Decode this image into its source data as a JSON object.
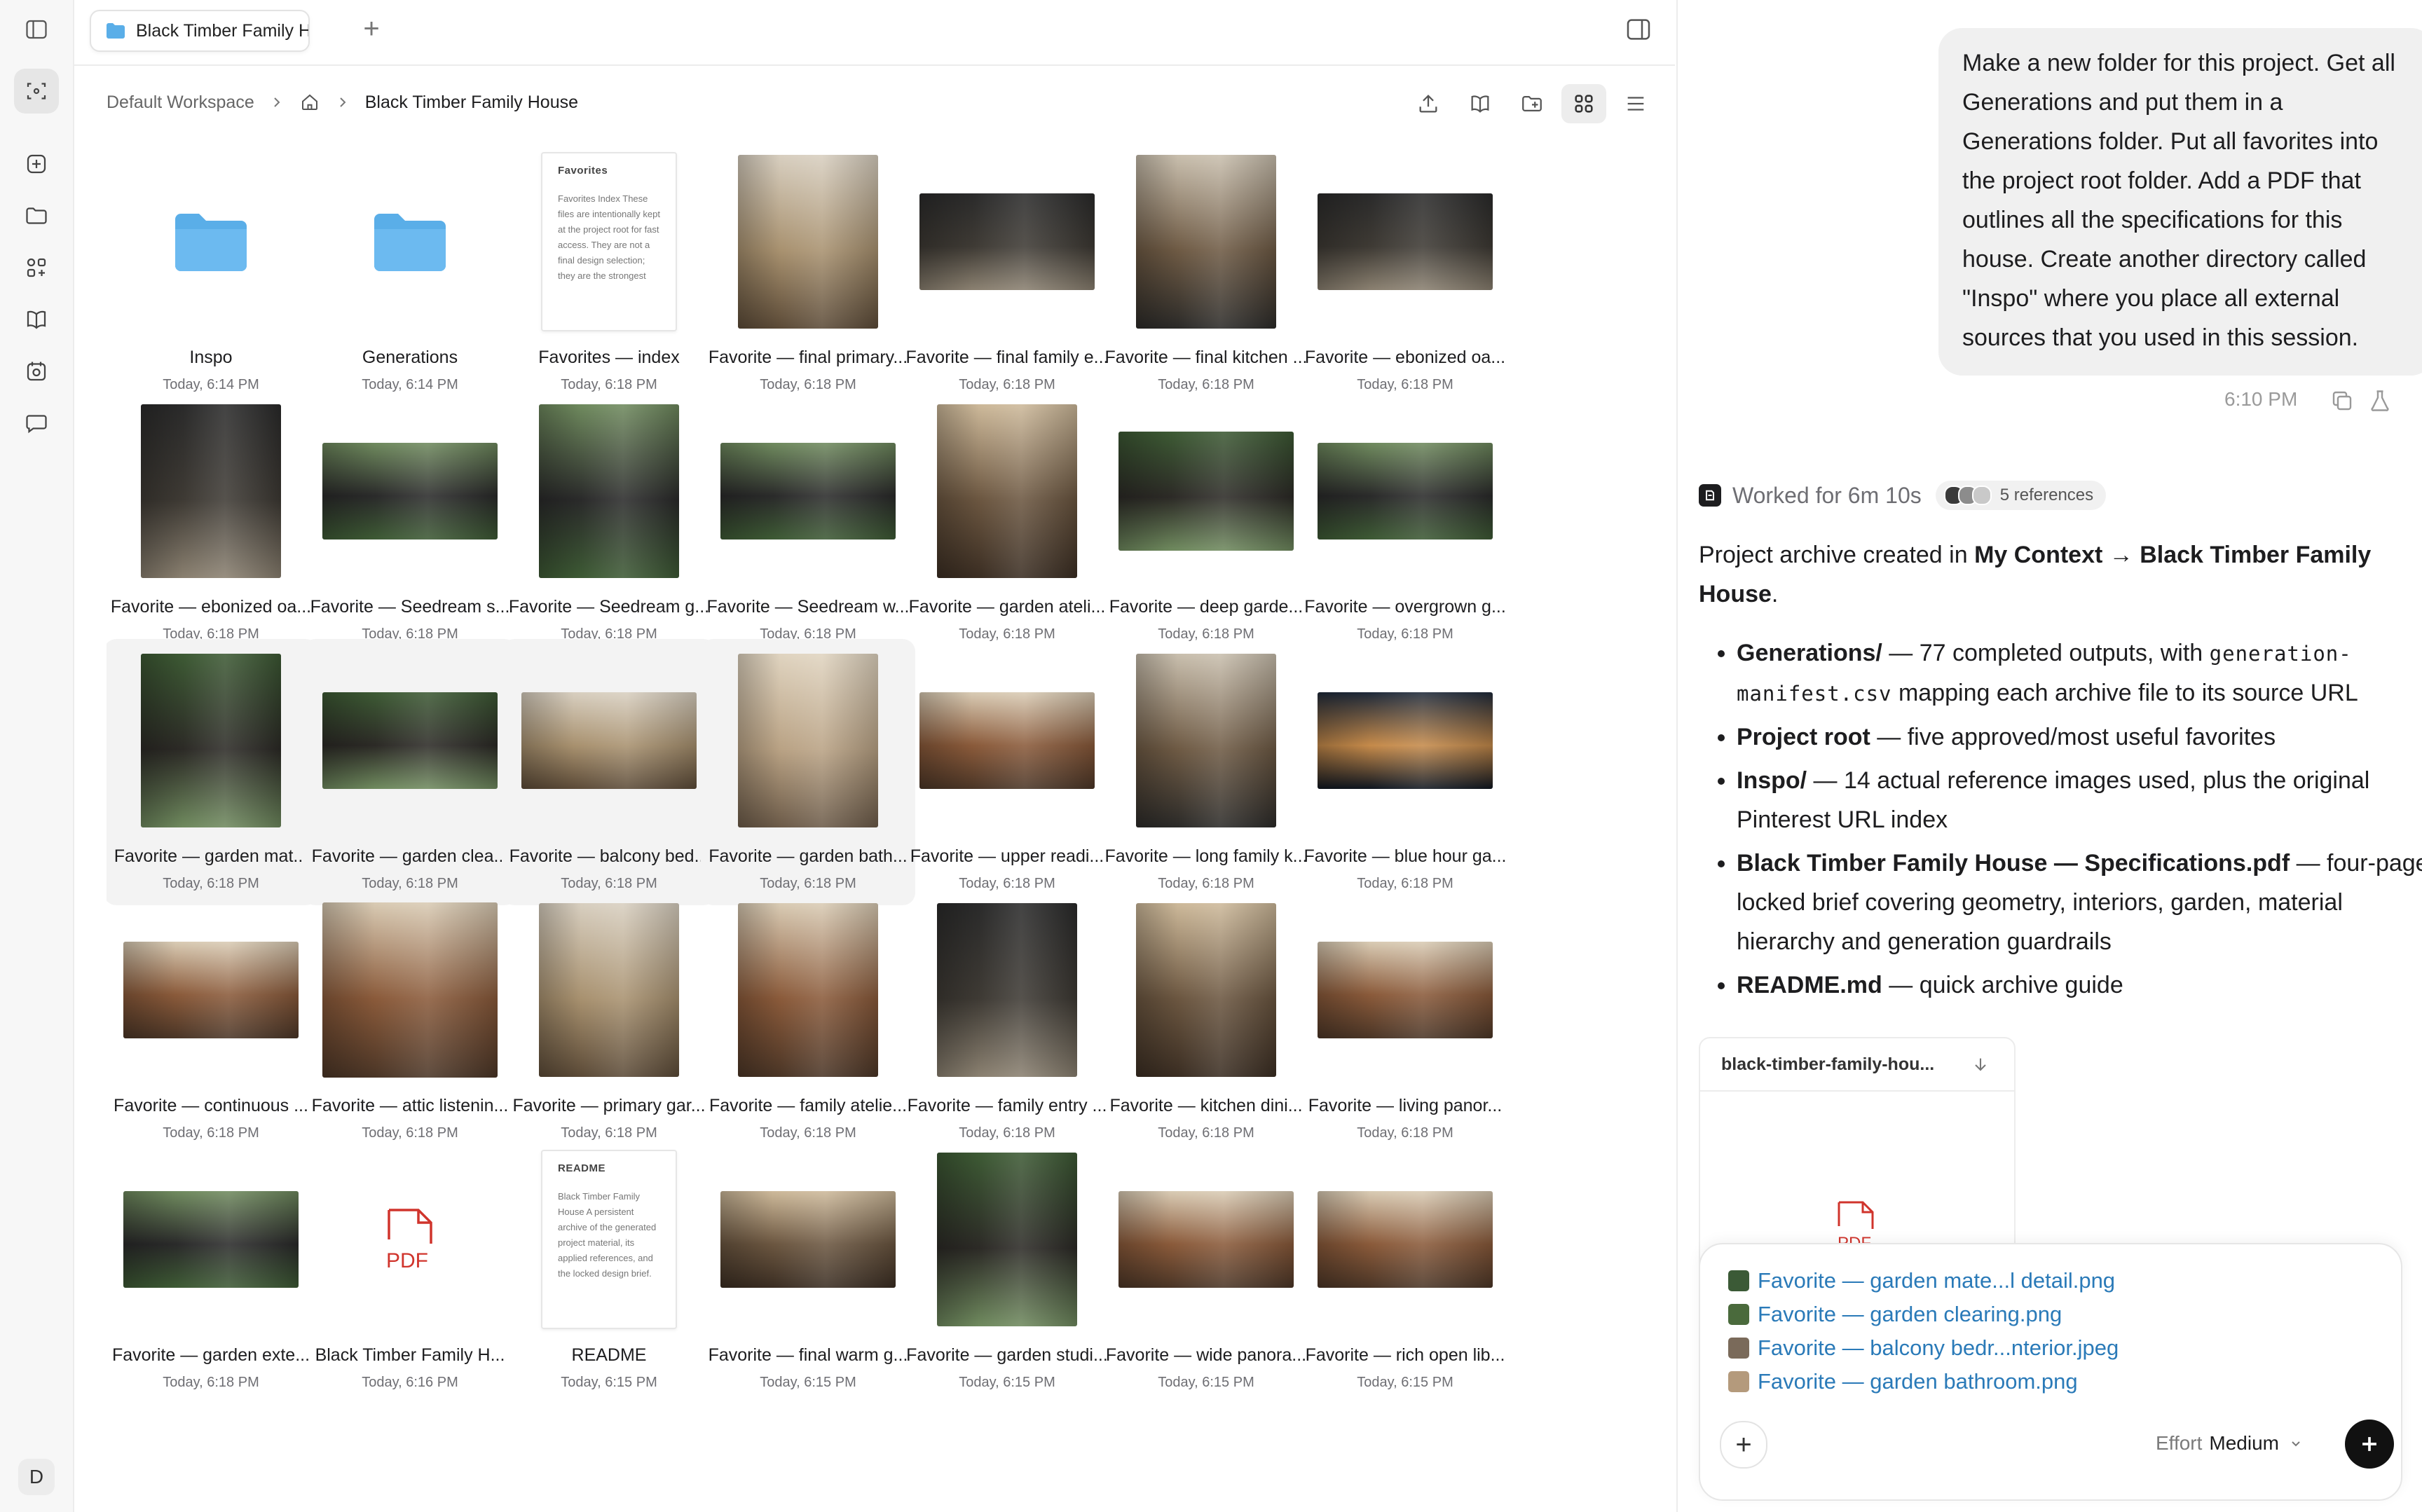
{
  "tab": {
    "title": "Black Timber Family House"
  },
  "breadcrumb": {
    "workspace": "Default Workspace",
    "current": "Black Timber Family House"
  },
  "grid": [
    {
      "name": "Inspo",
      "date": "Today, 6:14 PM",
      "kind": "folder"
    },
    {
      "name": "Generations",
      "date": "Today, 6:14 PM",
      "kind": "folder"
    },
    {
      "name": "Favorites — index",
      "date": "Today, 6:18 PM",
      "kind": "doc",
      "doc_title": "Favorites",
      "doc_text": "Favorites Index These files are intentionally kept at the project root for fast access. They are not a final design selection; they are the strongest"
    },
    {
      "name": "Favorite — final primary...",
      "date": "Today, 6:18 PM",
      "kind": "image",
      "tone": "bedroom",
      "shape": "tall"
    },
    {
      "name": "Favorite — final family e...",
      "date": "Today, 6:18 PM",
      "kind": "image",
      "tone": "dark",
      "shape": "wide"
    },
    {
      "name": "Favorite — final kitchen ...",
      "date": "Today, 6:18 PM",
      "kind": "image",
      "tone": "kitchen",
      "shape": "tall"
    },
    {
      "name": "Favorite — ebonized oa...",
      "date": "Today, 6:18 PM",
      "kind": "image",
      "tone": "dark",
      "shape": "wide"
    },
    {
      "name": "Favorite — ebonized oa...",
      "date": "Today, 6:18 PM",
      "kind": "image",
      "tone": "dark",
      "shape": "tall"
    },
    {
      "name": "Favorite — Seedream s...",
      "date": "Today, 6:18 PM",
      "kind": "image",
      "tone": "exterior",
      "shape": "wide"
    },
    {
      "name": "Favorite — Seedream g...",
      "date": "Today, 6:18 PM",
      "kind": "image",
      "tone": "exterior",
      "shape": "tall"
    },
    {
      "name": "Favorite — Seedream w...",
      "date": "Today, 6:18 PM",
      "kind": "image",
      "tone": "exterior",
      "shape": "wide"
    },
    {
      "name": "Favorite — garden ateli...",
      "date": "Today, 6:18 PM",
      "kind": "image",
      "tone": "interior",
      "shape": "tall"
    },
    {
      "name": "Favorite — deep garde...",
      "date": "Today, 6:18 PM",
      "kind": "image",
      "tone": "garden",
      "shape": "squareish"
    },
    {
      "name": "Favorite — overgrown g...",
      "date": "Today, 6:18 PM",
      "kind": "image",
      "tone": "exterior",
      "shape": "wide"
    },
    {
      "name": "Favorite — garden mat...",
      "date": "Today, 6:18 PM",
      "kind": "image",
      "tone": "garden",
      "shape": "tall",
      "selected": true
    },
    {
      "name": "Favorite — garden clea...",
      "date": "Today, 6:18 PM",
      "kind": "image",
      "tone": "garden",
      "shape": "wide",
      "selected": true
    },
    {
      "name": "Favorite — balcony bed...",
      "date": "Today, 6:18 PM",
      "kind": "image",
      "tone": "bedroom",
      "shape": "wide",
      "selected": true
    },
    {
      "name": "Favorite — garden bath...",
      "date": "Today, 6:18 PM",
      "kind": "image",
      "tone": "bath",
      "shape": "tall",
      "selected": true
    },
    {
      "name": "Favorite — upper readi...",
      "date": "Today, 6:18 PM",
      "kind": "image",
      "tone": "library",
      "shape": "wide"
    },
    {
      "name": "Favorite — long family k...",
      "date": "Today, 6:18 PM",
      "kind": "image",
      "tone": "kitchen",
      "shape": "tall"
    },
    {
      "name": "Favorite — blue hour ga...",
      "date": "Today, 6:18 PM",
      "kind": "image",
      "tone": "night",
      "shape": "wide"
    },
    {
      "name": "Favorite — continuous ...",
      "date": "Today, 6:18 PM",
      "kind": "image",
      "tone": "library",
      "shape": "wide"
    },
    {
      "name": "Favorite — attic listenin...",
      "date": "Today, 6:18 PM",
      "kind": "image",
      "tone": "library",
      "shape": "square"
    },
    {
      "name": "Favorite — primary gar...",
      "date": "Today, 6:18 PM",
      "kind": "image",
      "tone": "bedroom",
      "shape": "tall"
    },
    {
      "name": "Favorite — family atelie...",
      "date": "Today, 6:18 PM",
      "kind": "image",
      "tone": "library",
      "shape": "tall"
    },
    {
      "name": "Favorite — family entry ...",
      "date": "Today, 6:18 PM",
      "kind": "image",
      "tone": "dark",
      "shape": "tall"
    },
    {
      "name": "Favorite — kitchen dini...",
      "date": "Today, 6:18 PM",
      "kind": "image",
      "tone": "interior",
      "shape": "tall"
    },
    {
      "name": "Favorite — living panor...",
      "date": "Today, 6:18 PM",
      "kind": "image",
      "tone": "library",
      "shape": "wide"
    },
    {
      "name": "Favorite — garden exte...",
      "date": "Today, 6:18 PM",
      "kind": "image",
      "tone": "exterior",
      "shape": "wide"
    },
    {
      "name": "Black Timber Family H...",
      "date": "Today, 6:16 PM",
      "kind": "pdf"
    },
    {
      "name": "README",
      "date": "Today, 6:15 PM",
      "kind": "doc",
      "doc_title": "README",
      "doc_text": "Black Timber Family House A persistent archive of the generated project material, its applied references, and the locked design brief."
    },
    {
      "name": "Favorite — final warm g...",
      "date": "Today, 6:15 PM",
      "kind": "image",
      "tone": "interior",
      "shape": "wide"
    },
    {
      "name": "Favorite — garden studi...",
      "date": "Today, 6:15 PM",
      "kind": "image",
      "tone": "garden",
      "shape": "tall"
    },
    {
      "name": "Favorite — wide panora...",
      "date": "Today, 6:15 PM",
      "kind": "image",
      "tone": "library",
      "shape": "wide"
    },
    {
      "name": "Favorite — rich open lib...",
      "date": "Today, 6:15 PM",
      "kind": "image",
      "tone": "library",
      "shape": "wide"
    }
  ],
  "chat": {
    "user_message": "Make a new folder for this project. Get all Generations and put them in a Generations folder. Put all favorites into the project root folder. Add a PDF that outlines all the specifications for this house. Create another directory called \"Inspo\" where you place all external sources that you used in this session.",
    "time": "6:10 PM",
    "worked": "Worked for 6m 10s",
    "references": "5 references",
    "summary_prefix": "Project archive created in ",
    "summary_bold": "My Context → Black Timber Family House",
    "summary_suffix": ".",
    "bullets": [
      {
        "bold": "Generations/",
        "text_a": " — 77 completed outputs, with ",
        "code": "generation-manifest.csv",
        "text_b": " mapping each archive file to its source URL"
      },
      {
        "bold": "Project root",
        "text_a": " — five approved/most useful favorites",
        "code": "",
        "text_b": ""
      },
      {
        "bold": "Inspo/",
        "text_a": " — 14 actual reference images used, plus the original Pinterest URL index",
        "code": "",
        "text_b": ""
      },
      {
        "bold": "Black Timber Family House — Specifications.pdf",
        "text_a": " — four-page locked brief covering geometry, interiors, garden, material hierarchy and generation guardrails",
        "code": "",
        "text_b": ""
      },
      {
        "bold": "README.md",
        "text_a": " — quick archive guide",
        "code": "",
        "text_b": ""
      }
    ],
    "file_card": {
      "name": "black-timber-family-hou..."
    },
    "attachments": [
      {
        "name": "Favorite — garden mate...l detail.png",
        "color": "#3b5a36"
      },
      {
        "name": "Favorite — garden clearing.png",
        "color": "#4a6a3c"
      },
      {
        "name": "Favorite — balcony bedr...nterior.jpeg",
        "color": "#7a6a5a"
      },
      {
        "name": "Favorite — garden bathroom.png",
        "color": "#b49a7c"
      }
    ],
    "effort_label": "Effort",
    "effort_value": "Medium"
  },
  "avatar_letter": "D",
  "colors": {
    "folder": "#5aaee8",
    "accent": "#2a7ab8",
    "pdf": "#d0342c"
  }
}
